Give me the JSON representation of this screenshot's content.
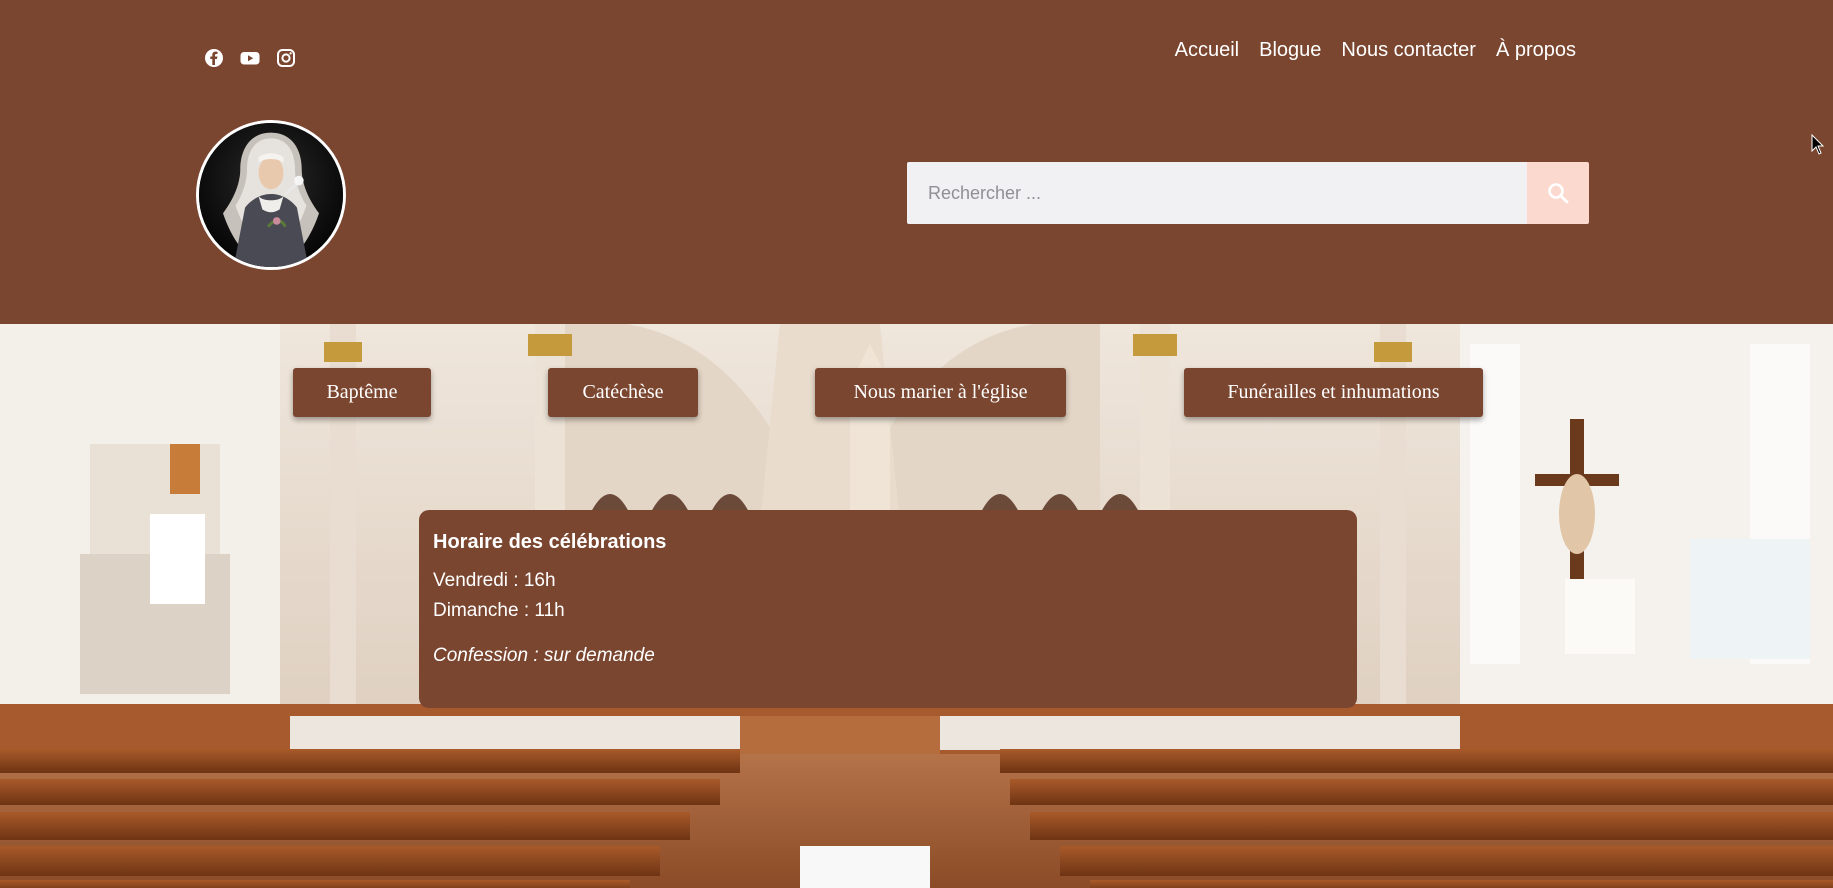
{
  "header": {
    "social": [
      {
        "icon": "facebook-icon"
      },
      {
        "icon": "youtube-icon"
      },
      {
        "icon": "instagram-icon"
      }
    ],
    "nav": [
      "Accueil",
      "Blogue",
      "Nous contacter",
      "À propos"
    ],
    "search": {
      "placeholder": "Rechercher ...",
      "value": "",
      "icon": "search-icon"
    }
  },
  "hero": {
    "buttons": [
      "Baptême",
      "Catéchèse",
      "Nous marier à l'église",
      "Funérailles et inhumations"
    ],
    "schedule": {
      "title": "Horaire des célébrations",
      "lines": [
        "Vendredi : 16h",
        "Dimanche : 11h"
      ],
      "confession": "Confession : sur demande"
    }
  },
  "colors": {
    "brand": "#7b4630",
    "search_button": "#fcd9cf",
    "text_light": "#ffffff"
  }
}
